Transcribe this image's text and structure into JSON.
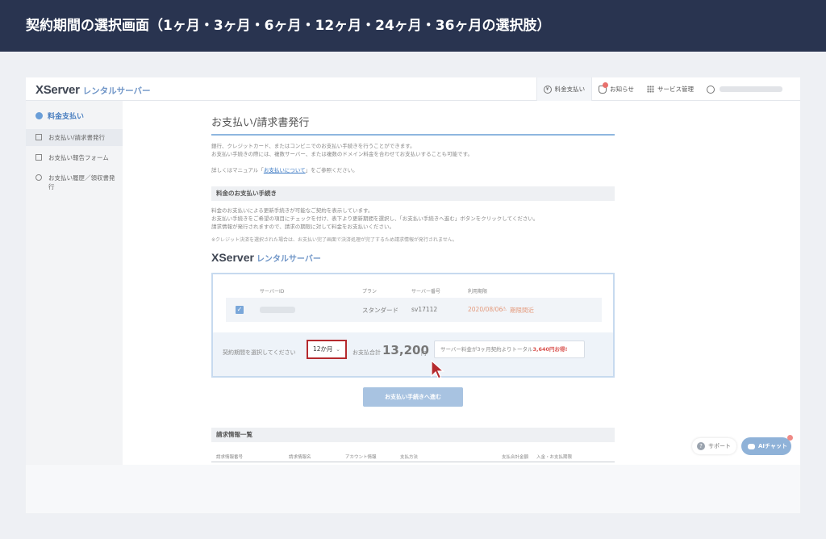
{
  "banner": {
    "title": "契約期間の選択画面（1ヶ月・3ヶ月・6ヶ月・12ヶ月・24ヶ月・36ヶ月の選択肢）"
  },
  "header": {
    "logo_main": "XServer",
    "logo_sub": "レンタルサーバー",
    "nav": {
      "billing": "料金支払い",
      "news": "お知らせ",
      "services": "サービス管理"
    }
  },
  "sidebar": {
    "section": "料金支払い",
    "items": [
      {
        "label": "お支払い/請求書発行"
      },
      {
        "label": "お支払い報告フォーム"
      },
      {
        "label": "お支払い履歴／領収書発行"
      }
    ]
  },
  "main": {
    "page_title": "お支払い/請求書発行",
    "intro_line1": "銀行、クレジットカード、またはコンビニでのお支払い手続きを行うことができます。",
    "intro_line2": "お支払い手続きの際には、複数サーバー、または複数のドメイン料金を合わせてお支払いすることも可能です。",
    "manual_prefix": "詳しくはマニュアル「",
    "manual_link": "お支払いについて",
    "manual_suffix": "」をご参照ください。",
    "procedure_heading": "料金のお支払い手続き",
    "procedure_line1": "料金のお支払いによる更新手続きが可能なご契約を表示しています。",
    "procedure_line2": "お支払い手続きをご希望の項目にチェックを付け、表下より更新期間を選択し、「お支払い手続きへ進む」ボタンをクリックしてください。",
    "procedure_line3": "請求情報が発行されますので、請求の期限に対して料金をお支払いください。",
    "note": "※クレジット決済を選択された場合は、お支払い完了画面で決済処理が完了するため請求情報が発行されません。",
    "product_logo_main": "XServer",
    "product_logo_sub": "レンタルサーバー",
    "table": {
      "headers": {
        "server_id": "サーバーID",
        "plan": "プラン",
        "server_no": "サーバー番号",
        "expiry": "利用期限"
      },
      "row": {
        "plan": "スタンダード",
        "server_no": "sv17112",
        "expiry": "2020/08/06",
        "status": "期限間近",
        "checked": "✓"
      }
    },
    "period_label": "契約期間を選択してください",
    "period_selected": "12か月",
    "total_label": "お支払合計",
    "total_value": "13,200",
    "total_unit": "円",
    "promo_text": "サーバー料金が3ヶ月契約よりトータル",
    "promo_highlight": "3,640円お得!",
    "pay_button": "お支払い手続きへ進む",
    "invoice_heading": "請求情報一覧",
    "invoice_headers": {
      "number": "請求情報番号",
      "name": "請求情報名",
      "account": "アカウント情報",
      "method": "支払方法",
      "amount": "支払合計金額",
      "deposit": "入金・お支払期限"
    }
  },
  "widgets": {
    "support": "サポート",
    "ai_chat": "AIチャット"
  }
}
